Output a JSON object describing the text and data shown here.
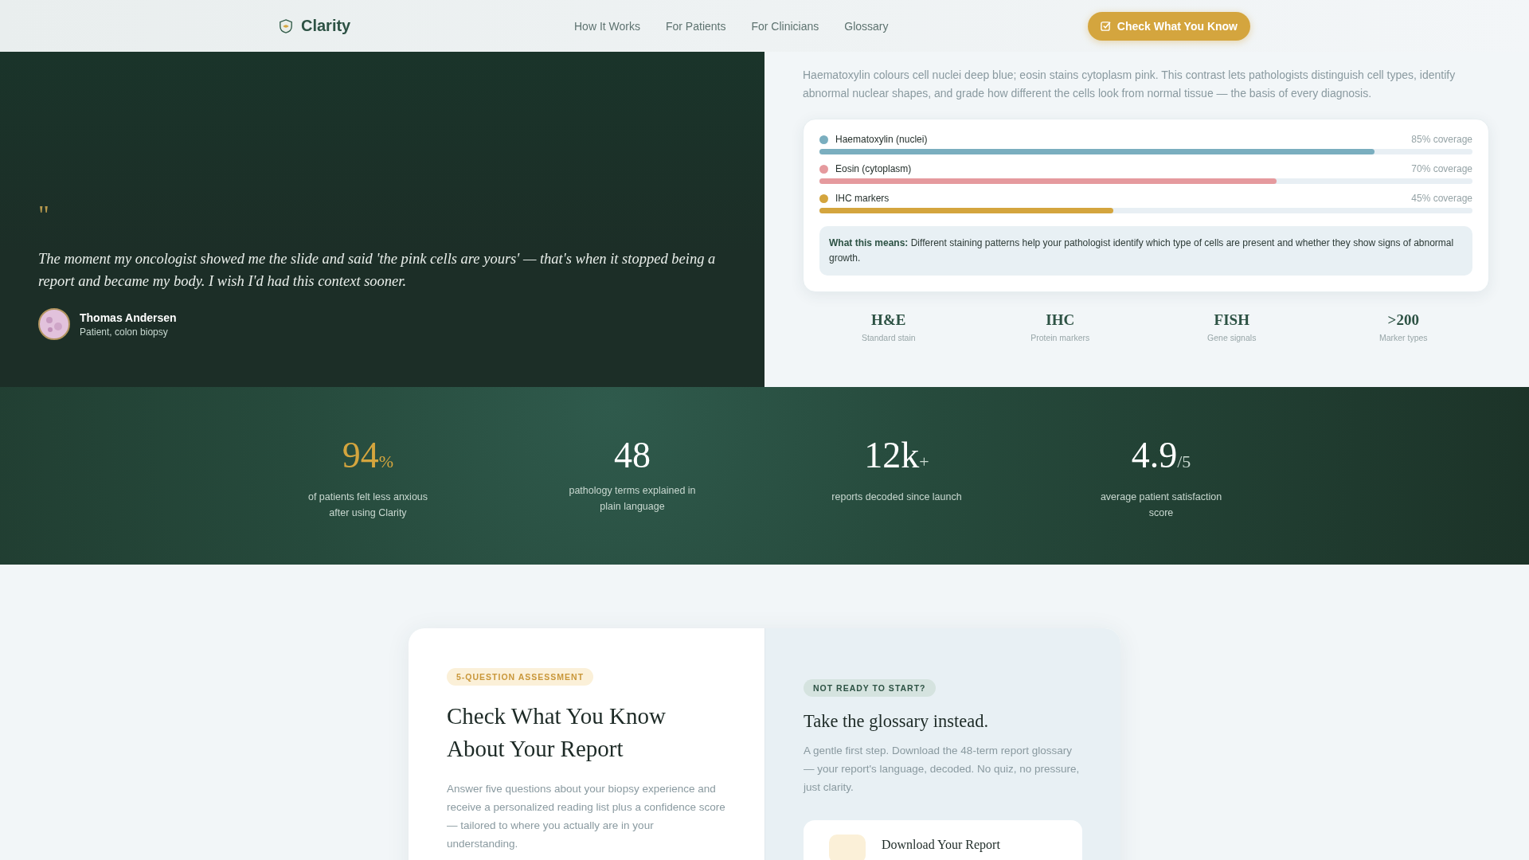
{
  "header": {
    "brand": "Clarity",
    "nav": [
      "How It Works",
      "For Patients",
      "For Clinicians",
      "Glossary"
    ],
    "cta": "Check What You Know"
  },
  "testimonial": {
    "quote_mark": "\"",
    "quote": "The moment my oncologist showed me the slide and said 'the pink cells are yours' — that's when it stopped being a report and became my body. I wish I'd had this context sooner.",
    "author": "Thomas Andersen",
    "role": "Patient, colon biopsy"
  },
  "stain_panel": {
    "intro": "Haematoxylin colours cell nuclei deep blue; eosin stains cytoplasm pink. This contrast lets pathologists distinguish cell types, identify abnormal nuclear shapes, and grade how different the cells look from normal tissue — the basis of every diagnosis.",
    "stains": [
      {
        "name": "Haematoxylin (nuclei)",
        "reading": "85% coverage",
        "level": 0.85,
        "color": "#7aaebf"
      },
      {
        "name": "Eosin (cytoplasm)",
        "reading": "70% coverage",
        "level": 0.7,
        "color": "#e59a9e"
      },
      {
        "name": "IHC markers",
        "reading": "45% coverage",
        "level": 0.45,
        "color": "#d4a53e"
      }
    ],
    "note": "**What this means:** Different staining patterns help your pathologist identify which type of cells are present and whether they show signs of abnormal growth.",
    "methods": [
      {
        "value": "H&E",
        "label": "Standard stain"
      },
      {
        "value": "IHC",
        "label": "Protein markers"
      },
      {
        "value": "FISH",
        "label": "Gene signals"
      },
      {
        "value": ">200",
        "label": "Marker types"
      }
    ]
  },
  "stats": [
    {
      "value": "94",
      "suffix": "%",
      "label": "of patients felt less anxious after using Clarity",
      "kind": "accent"
    },
    {
      "value": "48",
      "label": "pathology terms explained in plain language",
      "kind": "plain"
    },
    {
      "value": "12k",
      "suffix": "+",
      "label": "reports decoded since launch",
      "kind": "plain"
    },
    {
      "value": "4.9",
      "suffix": "/5",
      "label": "average patient satisfaction score",
      "kind": "plain"
    }
  ],
  "assessment": {
    "badge": "5-QUESTION ASSESSMENT",
    "title": "Check What You Know About Your Report",
    "text": "Answer five questions about your biopsy experience and receive a personalized reading list plus a confidence score — tailored to where you actually are in your understanding."
  },
  "alternative": {
    "badge": "NOT READY TO START?",
    "title": "Take the glossary instead.",
    "text": "A gentle first step. Download the 48-term report glossary — your report's language, decoded. No quiz, no pressure, just clarity.",
    "download_title": "Download Your Report"
  }
}
